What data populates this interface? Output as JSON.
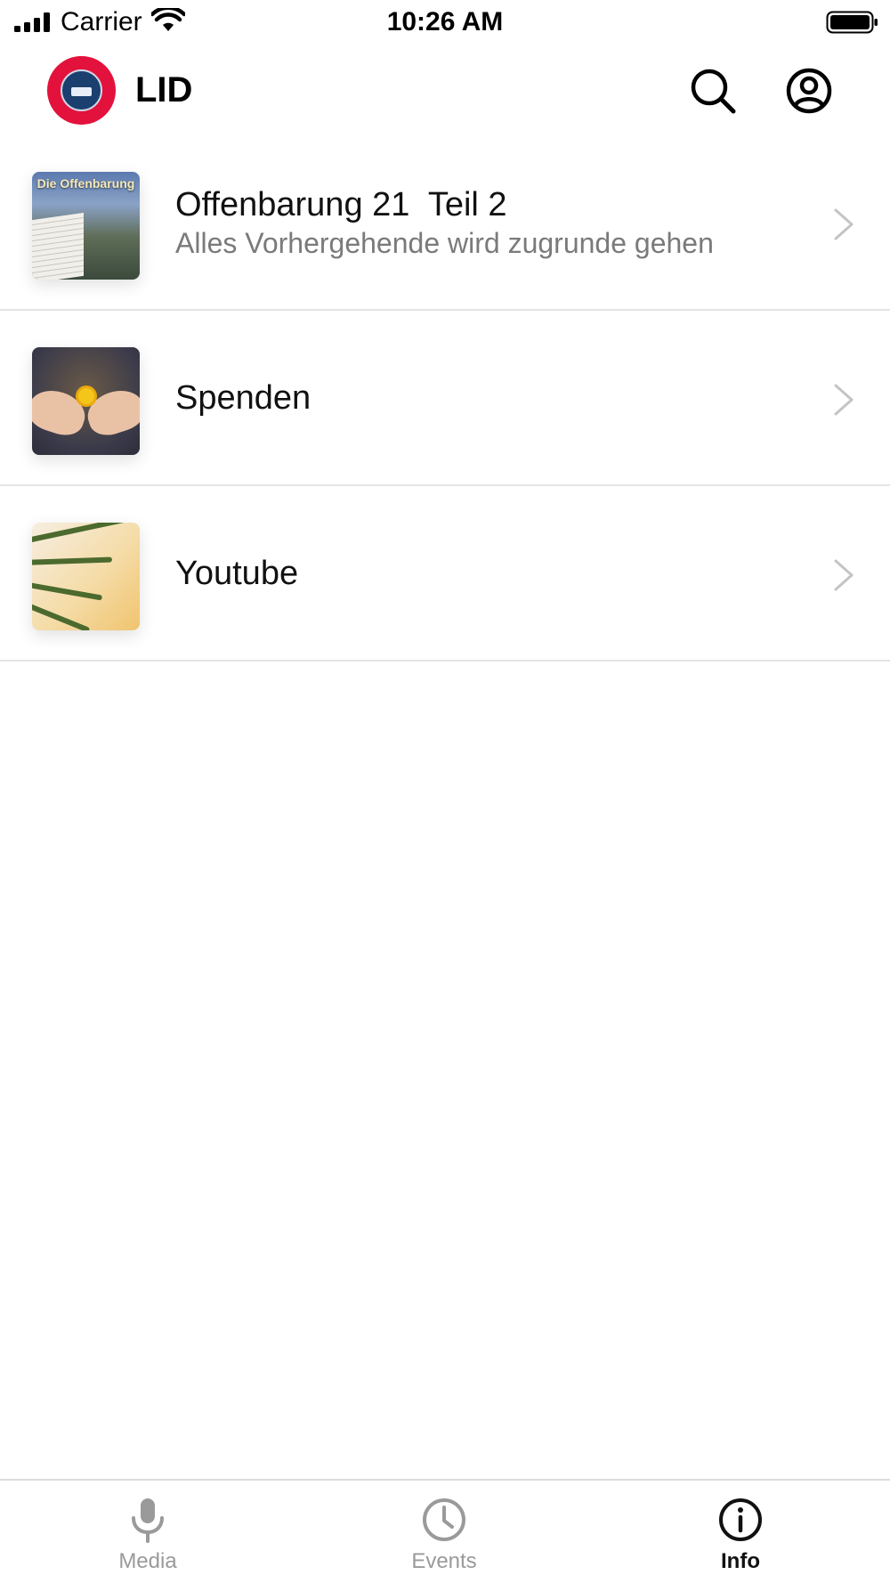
{
  "status_bar": {
    "carrier": "Carrier",
    "time": "10:26 AM"
  },
  "header": {
    "title": "LID",
    "actions": [
      "search-icon",
      "profile-icon"
    ]
  },
  "list": {
    "items": [
      {
        "title": "Offenbarung 21  Teil 2",
        "subtitle": "Alles Vorhergehende wird zugrunde gehen",
        "thumbnail_text": "Die Offenbarung"
      },
      {
        "title": "Spenden",
        "subtitle": ""
      },
      {
        "title": "Youtube",
        "subtitle": ""
      }
    ]
  },
  "tab_bar": {
    "tabs": [
      {
        "label": "Media",
        "icon": "microphone-icon",
        "active": false
      },
      {
        "label": "Events",
        "icon": "clock-icon",
        "active": false
      },
      {
        "label": "Info",
        "icon": "info-icon",
        "active": true
      }
    ]
  },
  "colors": {
    "brand": "#e3123d",
    "inactive_tab": "#9a9a9a",
    "active_tab": "#111111",
    "subtitle": "#7a7a7a",
    "divider": "#e4e4e4"
  }
}
